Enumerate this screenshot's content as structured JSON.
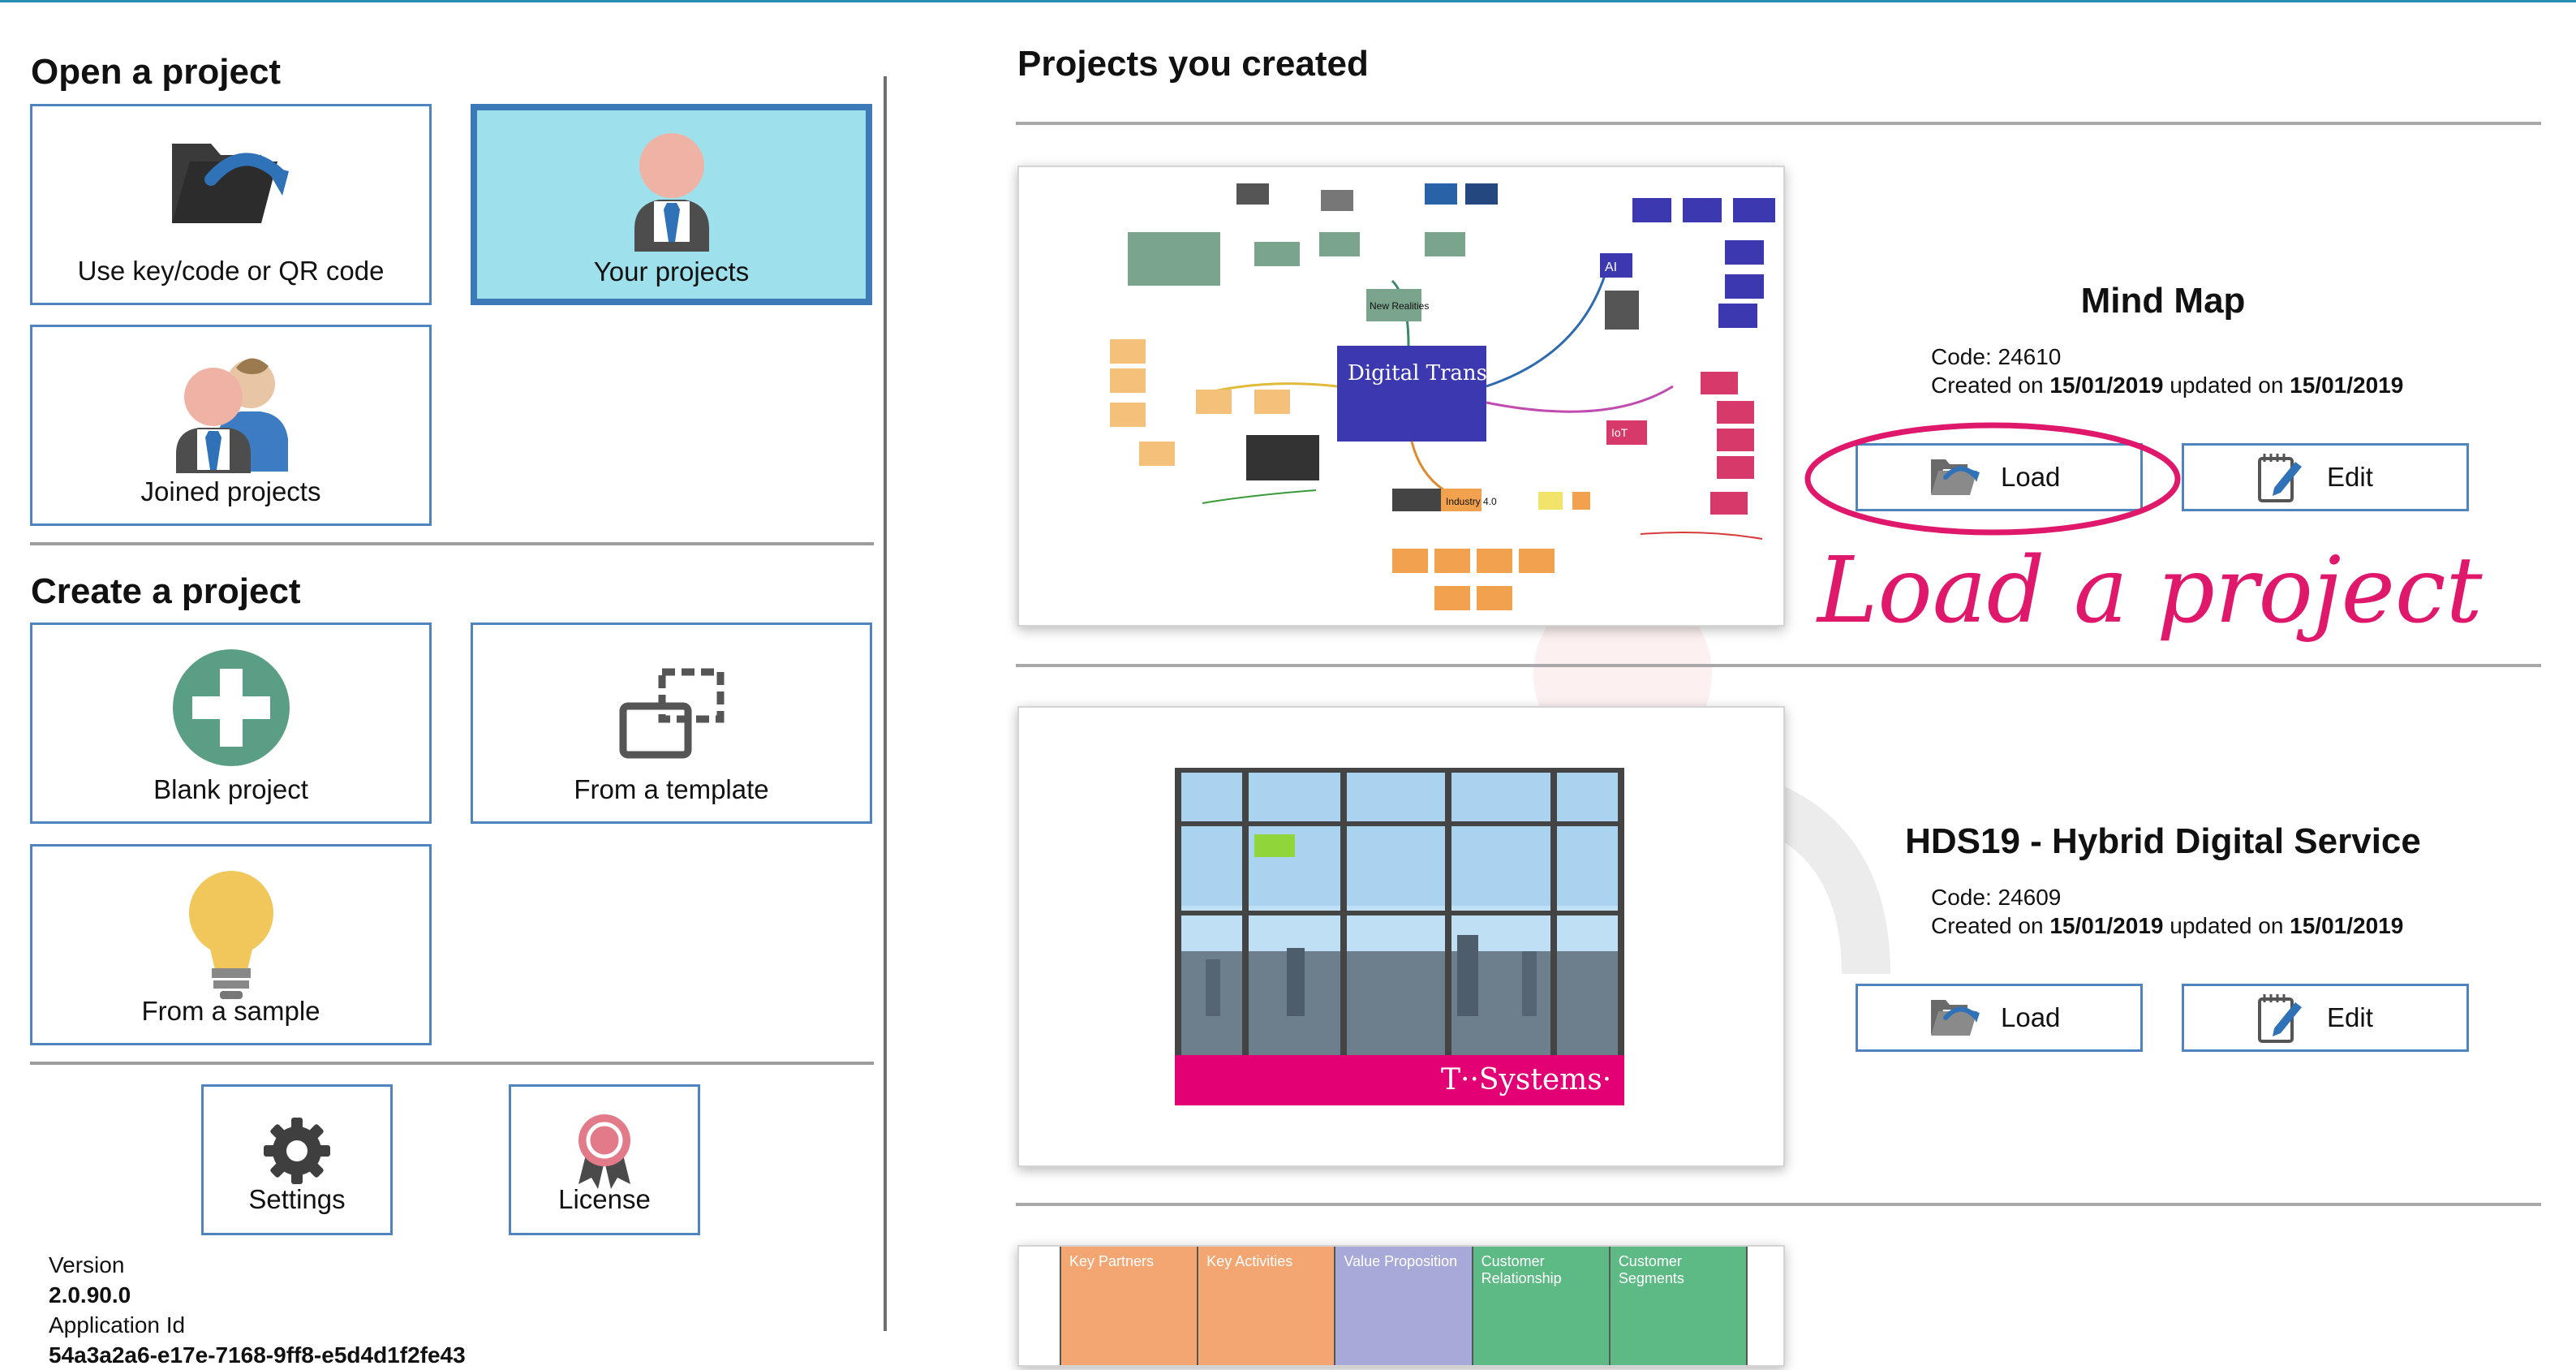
{
  "open_section": {
    "title": "Open a project",
    "tiles": [
      {
        "label": "Use key/code or QR code",
        "icon": "folder-arrow-icon"
      },
      {
        "label": "Your projects",
        "icon": "person-icon",
        "selected": true
      },
      {
        "label": "Joined projects",
        "icon": "people-icon"
      }
    ]
  },
  "create_section": {
    "title": "Create a project",
    "tiles": [
      {
        "label": "Blank project",
        "icon": "plus-circle-icon"
      },
      {
        "label": "From a template",
        "icon": "template-icon"
      },
      {
        "label": "From a sample",
        "icon": "lightbulb-icon"
      }
    ]
  },
  "footer_buttons": {
    "settings": "Settings",
    "license": "License"
  },
  "app_info": {
    "version_label": "Version",
    "version": "2.0.90.0",
    "app_id_label": "Application Id",
    "app_id": "54a3a2a6-e17e-7168-9ff8-e5d4d1f2fe43"
  },
  "projects_panel": {
    "title": "Projects you created",
    "projects": [
      {
        "name": "Mind Map",
        "code_label": "Code:",
        "code": "24610",
        "created_label": "Created on",
        "created": "15/01/2019",
        "updated_label": "updated on",
        "updated": "15/01/2019",
        "load_label": "Load",
        "edit_label": "Edit",
        "thumbnail_texts": [
          "Digital Transformation",
          "New Realities",
          "AI",
          "IoT",
          "Industry 4.0"
        ]
      },
      {
        "name": "HDS19 - Hybrid Digital Service",
        "code_label": "Code:",
        "code": "24609",
        "created_label": "Created on",
        "created": "15/01/2019",
        "updated_label": "updated on",
        "updated": "15/01/2019",
        "load_label": "Load",
        "edit_label": "Edit",
        "thumbnail_texts": [
          "T··Systems·"
        ]
      }
    ],
    "canvas_columns": [
      "Key Partners",
      "Key Activities",
      "Value Proposition",
      "Customer Relationship",
      "Customer Segments"
    ],
    "canvas_colors": [
      "#f3a672",
      "#f3a672",
      "#a7a9d8",
      "#5dba85",
      "#5dba85"
    ]
  },
  "annotation": {
    "text": "Load a project",
    "color": "#e0186c"
  },
  "colors": {
    "tile_border": "#4f84bf",
    "selected_tile_bg": "#9ee0eb",
    "accent_line": "#2b8fb4"
  }
}
